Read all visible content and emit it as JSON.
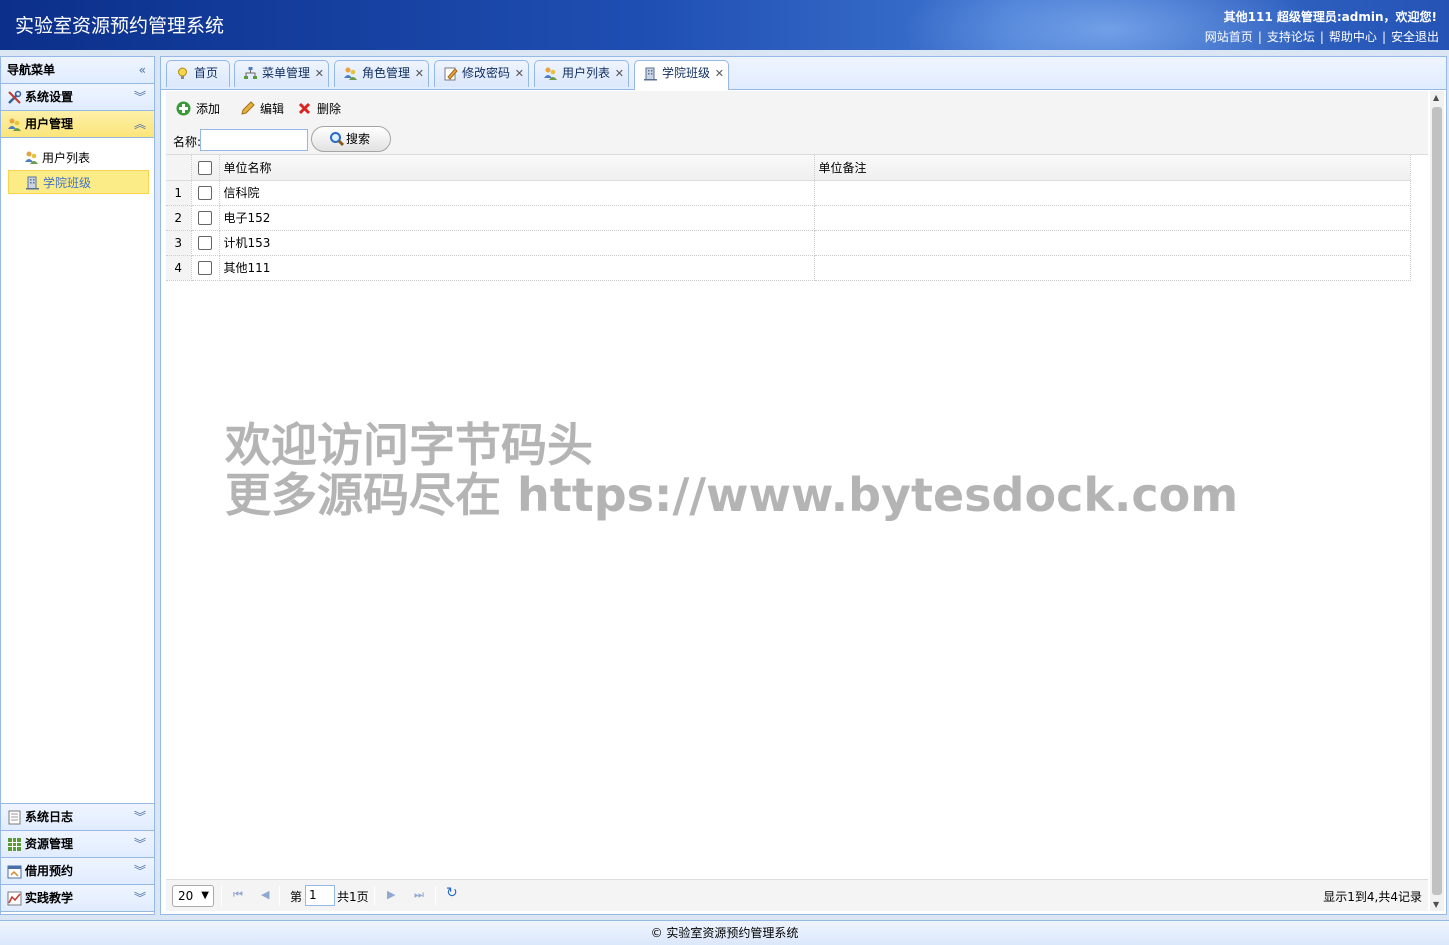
{
  "header": {
    "app_title": "实验室资源预约管理系统",
    "welcome": "其他111 超级管理员:admin，欢迎您!",
    "links": [
      "网站首页",
      "支持论坛",
      "帮助中心",
      "安全退出"
    ]
  },
  "sidebar": {
    "title": "导航菜单",
    "collapse_icon": "«",
    "sections": [
      {
        "label": "系统设置",
        "icon": "tools-icon",
        "expanded": false
      },
      {
        "label": "用户管理",
        "icon": "users-icon",
        "expanded": true
      },
      {
        "label": "系统日志",
        "icon": "log-icon",
        "expanded": false
      },
      {
        "label": "资源管理",
        "icon": "grid-icon",
        "expanded": false
      },
      {
        "label": "借用预约",
        "icon": "calendar-icon",
        "expanded": false
      },
      {
        "label": "实践教学",
        "icon": "chart-icon",
        "expanded": false
      }
    ],
    "user_items": [
      {
        "label": "用户列表",
        "selected": false
      },
      {
        "label": "学院班级",
        "selected": true
      }
    ]
  },
  "tabs": [
    {
      "label": "首页",
      "closable": false
    },
    {
      "label": "菜单管理",
      "closable": true
    },
    {
      "label": "角色管理",
      "closable": true
    },
    {
      "label": "修改密码",
      "closable": true
    },
    {
      "label": "用户列表",
      "closable": true
    },
    {
      "label": "学院班级",
      "closable": true,
      "active": true
    }
  ],
  "toolbar": {
    "add_label": "添加",
    "edit_label": "编辑",
    "delete_label": "删除",
    "search_label": "名称:",
    "search_value": "",
    "search_button": "搜索"
  },
  "grid": {
    "columns": [
      "单位名称",
      "单位备注"
    ],
    "rows": [
      {
        "num": "1",
        "name": "信科院",
        "note": ""
      },
      {
        "num": "2",
        "name": "电子152",
        "note": ""
      },
      {
        "num": "3",
        "name": "计机153",
        "note": ""
      },
      {
        "num": "4",
        "name": "其他111",
        "note": ""
      }
    ]
  },
  "pager": {
    "page_size": "20",
    "page_prefix": "第",
    "page_value": "1",
    "page_suffix": "共1页",
    "info": "显示1到4,共4记录"
  },
  "watermark": {
    "line1": "欢迎访问字节码头",
    "line2": "更多源码尽在  https://www.bytesdock.com"
  },
  "footer": {
    "text": "© 实验室资源预约管理系统"
  },
  "colors": {
    "header_dark": "#0b2f8a",
    "panel_border": "#95b8e7",
    "selected_bg": "#fbec88"
  }
}
